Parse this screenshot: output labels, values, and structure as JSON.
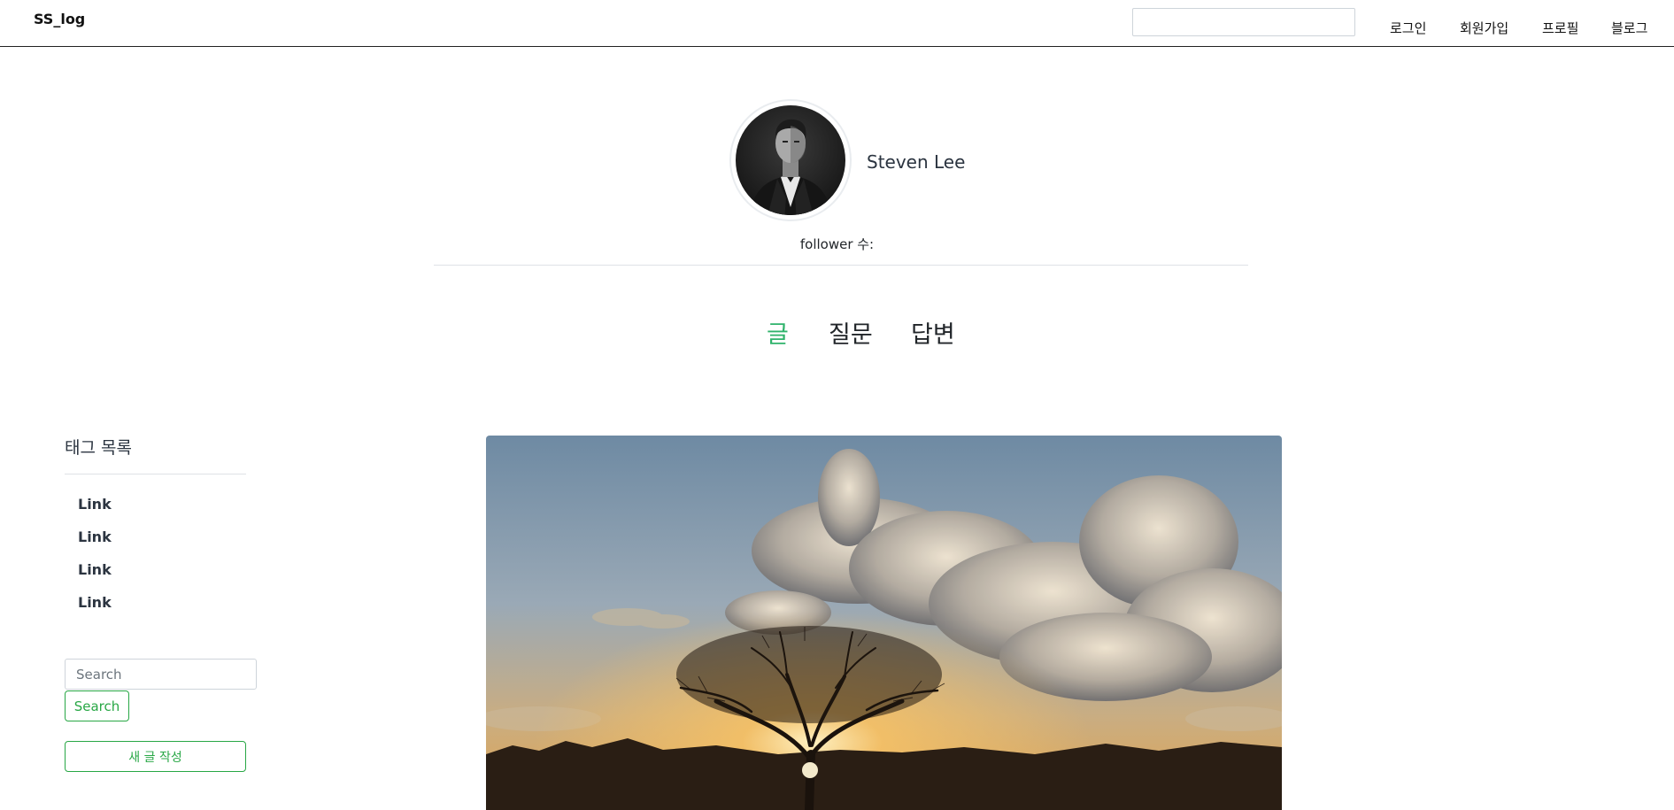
{
  "navbar": {
    "brand": "SS_log",
    "search_value": "",
    "links": [
      "로그인",
      "회원가입",
      "프로필",
      "블로그"
    ]
  },
  "profile": {
    "name": "Steven Lee",
    "follower_label": "follower 수:"
  },
  "tabs": [
    {
      "label": "글",
      "active": true
    },
    {
      "label": "질문",
      "active": false
    },
    {
      "label": "답변",
      "active": false
    }
  ],
  "sidebar": {
    "title": "태그 목록",
    "tags": [
      "Link",
      "Link",
      "Link",
      "Link"
    ],
    "search_placeholder": "Search",
    "search_button": "Search",
    "new_post_button": "새 글 작성"
  },
  "colors": {
    "accent_green": "#2fb36b",
    "button_green": "#28a745",
    "navbar_border": "#222222"
  }
}
